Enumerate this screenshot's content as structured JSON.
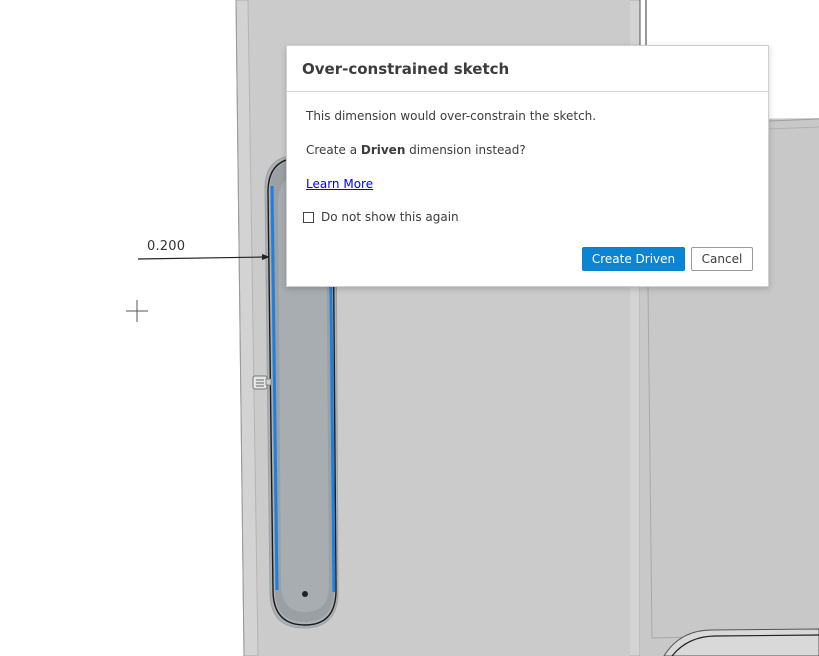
{
  "canvas": {
    "dimension_value": "0.200"
  },
  "dialog": {
    "title": "Over-constrained sketch",
    "message_line": "This dimension would over-constrain the sketch.",
    "prompt_prefix": "Create a ",
    "prompt_bold": "Driven",
    "prompt_suffix": " dimension instead?",
    "learn_more": "Learn More",
    "checkbox_label": "Do not show this again",
    "checkbox_checked": false,
    "primary_button": "Create Driven",
    "cancel_button": "Cancel"
  },
  "colors": {
    "primary_button": "#0b85d3",
    "selection_highlight": "#1f7fe0",
    "viewport_grey": "#c8c8c8",
    "link": "#0000ee"
  }
}
